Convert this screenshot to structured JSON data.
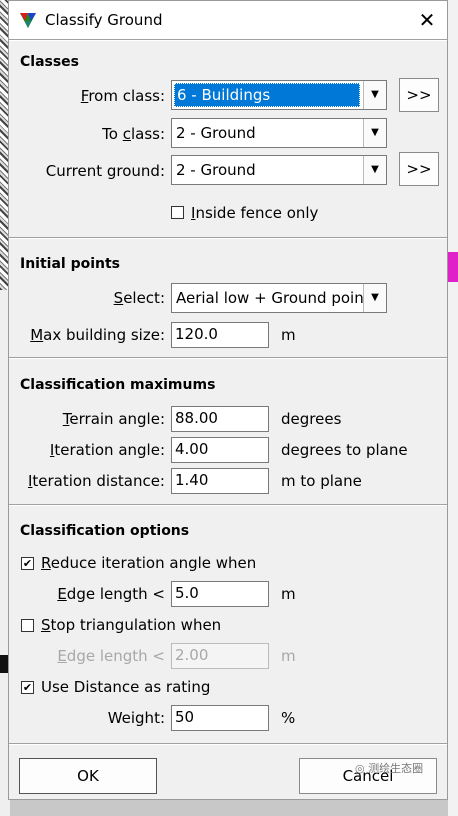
{
  "window": {
    "title": "Classify Ground",
    "close_glyph": "✕"
  },
  "classes": {
    "header": "Classes",
    "from_label_pre": "",
    "from_label_key": "F",
    "from_label_post": "rom class:",
    "from_value": "6 - Buildings",
    "to_label_pre": "To ",
    "to_label_key": "c",
    "to_label_post": "lass:",
    "to_value": "2 - Ground",
    "current_label": "Current ground:",
    "current_value": "2 - Ground",
    "more_button": ">>",
    "inside_fence_key": "I",
    "inside_fence_post": "nside fence only",
    "inside_fence_checked": false
  },
  "initial": {
    "header": "Initial points",
    "select_label_key": "S",
    "select_label_post": "elect:",
    "select_value": "Aerial low + Ground points",
    "maxb_label_key": "M",
    "maxb_label_post": "ax building size:",
    "maxb_value": "120.0",
    "maxb_unit": "m"
  },
  "maximums": {
    "header": "Classification maximums",
    "terrain_key": "T",
    "terrain_post": "errain angle:",
    "terrain_value": "88.00",
    "terrain_unit": "degrees",
    "iter_angle_key": "I",
    "iter_angle_post": "teration angle:",
    "iter_angle_value": "4.00",
    "iter_angle_unit": "degrees to plane",
    "iter_dist_key": "I",
    "iter_dist_post": "teration distance:",
    "iter_dist_value": "1.40",
    "iter_dist_unit": "m to plane"
  },
  "options": {
    "header": "Classification options",
    "reduce_key": "R",
    "reduce_post": "educe iteration angle when",
    "reduce_checked": true,
    "edge1_key": "E",
    "edge1_post": "dge length <",
    "edge1_value": "5.0",
    "edge1_unit": "m",
    "stop_key": "S",
    "stop_post": "top triangulation when",
    "stop_checked": false,
    "edge2_key": "E",
    "edge2_post": "dge length <",
    "edge2_value": "2.00",
    "edge2_unit": "m",
    "usedist_label": "Use Distance as rating",
    "usedist_checked": true,
    "weight_label": "Weight:",
    "weight_value": "50",
    "weight_unit": "%"
  },
  "footer": {
    "ok": "OK",
    "cancel": "Cancel"
  },
  "watermark": "测绘生态圈",
  "colors": {
    "selection": "#0078d7",
    "dialog_bg": "#f0f0f0",
    "check": "#000000"
  }
}
